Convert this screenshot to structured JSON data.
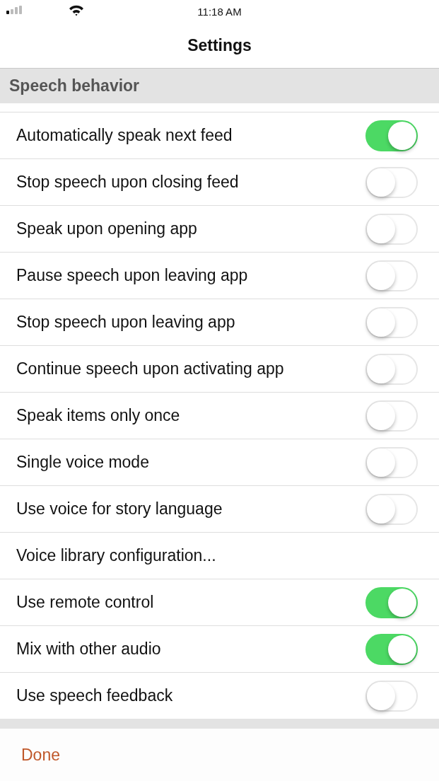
{
  "status_bar": {
    "time": "11:18 AM"
  },
  "nav": {
    "title": "Settings"
  },
  "section": {
    "title": "Speech behavior"
  },
  "rows": [
    {
      "kind": "toggle",
      "label": "Automatically speak next feed",
      "on": true
    },
    {
      "kind": "toggle",
      "label": "Stop speech upon closing feed",
      "on": false
    },
    {
      "kind": "toggle",
      "label": "Speak upon opening app",
      "on": false
    },
    {
      "kind": "toggle",
      "label": "Pause speech upon leaving app",
      "on": false
    },
    {
      "kind": "toggle",
      "label": "Stop speech upon leaving app",
      "on": false
    },
    {
      "kind": "toggle",
      "label": "Continue speech upon activating app",
      "on": false
    },
    {
      "kind": "toggle",
      "label": "Speak items only once",
      "on": false
    },
    {
      "kind": "toggle",
      "label": "Single voice mode",
      "on": false
    },
    {
      "kind": "toggle",
      "label": "Use voice for story language",
      "on": false
    },
    {
      "kind": "link",
      "label": "Voice library configuration..."
    },
    {
      "kind": "toggle",
      "label": "Use remote control",
      "on": true
    },
    {
      "kind": "toggle",
      "label": "Mix with other audio",
      "on": true
    },
    {
      "kind": "toggle",
      "label": "Use speech feedback",
      "on": false
    }
  ],
  "footer": {
    "button": "Done"
  }
}
